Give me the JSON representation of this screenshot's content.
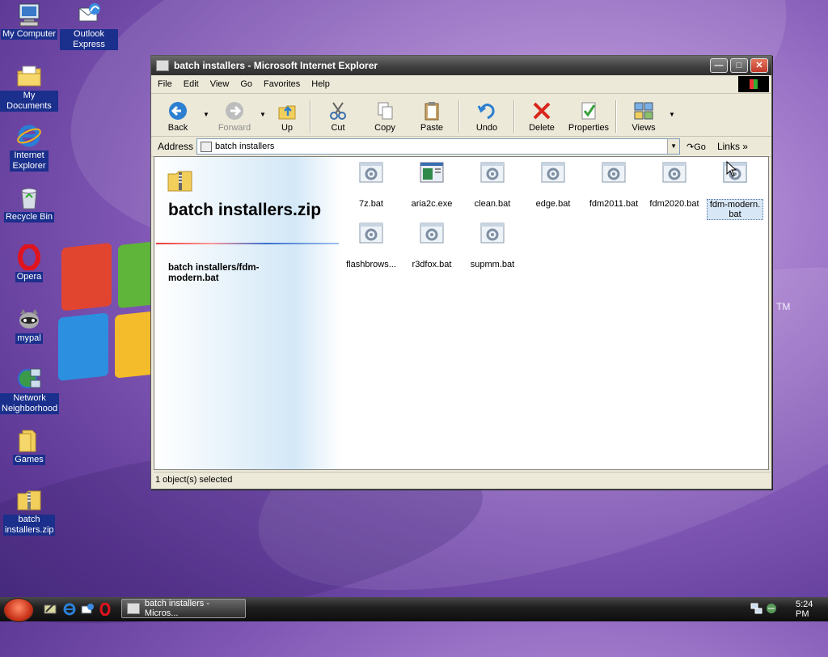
{
  "desktop": {
    "icons": [
      {
        "label": "My Computer"
      },
      {
        "label": "Outlook Express"
      },
      {
        "label": "My Documents"
      },
      {
        "label": "Internet Explorer"
      },
      {
        "label": "Recycle Bin"
      },
      {
        "label": "Opera"
      },
      {
        "label": "mypal"
      },
      {
        "label": "Network Neighborhood"
      },
      {
        "label": "Games"
      },
      {
        "label": "batch installers.zip"
      }
    ],
    "trademark": "TM"
  },
  "window": {
    "title": "batch installers - Microsoft Internet Explorer",
    "menu": [
      "File",
      "Edit",
      "View",
      "Go",
      "Favorites",
      "Help"
    ],
    "toolbar": {
      "back": "Back",
      "forward": "Forward",
      "up": "Up",
      "cut": "Cut",
      "copy": "Copy",
      "paste": "Paste",
      "undo": "Undo",
      "delete": "Delete",
      "properties": "Properties",
      "views": "Views"
    },
    "address": {
      "label": "Address",
      "value": "batch installers",
      "go": "Go",
      "links": "Links"
    },
    "left_pane": {
      "folder_title": "batch installers.zip",
      "selected_path": "batch installers/fdm-modern.bat"
    },
    "files": [
      {
        "name": "7z.bat",
        "icon": "batch-file-icon"
      },
      {
        "name": "aria2c.exe",
        "icon": "exe-file-icon"
      },
      {
        "name": "clean.bat",
        "icon": "batch-file-icon"
      },
      {
        "name": "edge.bat",
        "icon": "batch-file-icon"
      },
      {
        "name": "fdm2011.bat",
        "icon": "batch-file-icon"
      },
      {
        "name": "fdm2020.bat",
        "icon": "batch-file-icon"
      },
      {
        "name": "fdm-modern.bat",
        "icon": "batch-file-icon",
        "selected": true
      },
      {
        "name": "flashbrows...",
        "icon": "batch-file-icon"
      },
      {
        "name": "r3dfox.bat",
        "icon": "batch-file-icon"
      },
      {
        "name": "supmm.bat",
        "icon": "batch-file-icon"
      }
    ],
    "status": "1 object(s) selected"
  },
  "taskbar": {
    "task_label": "batch installers - Micros...",
    "clock": "5:24 PM"
  }
}
